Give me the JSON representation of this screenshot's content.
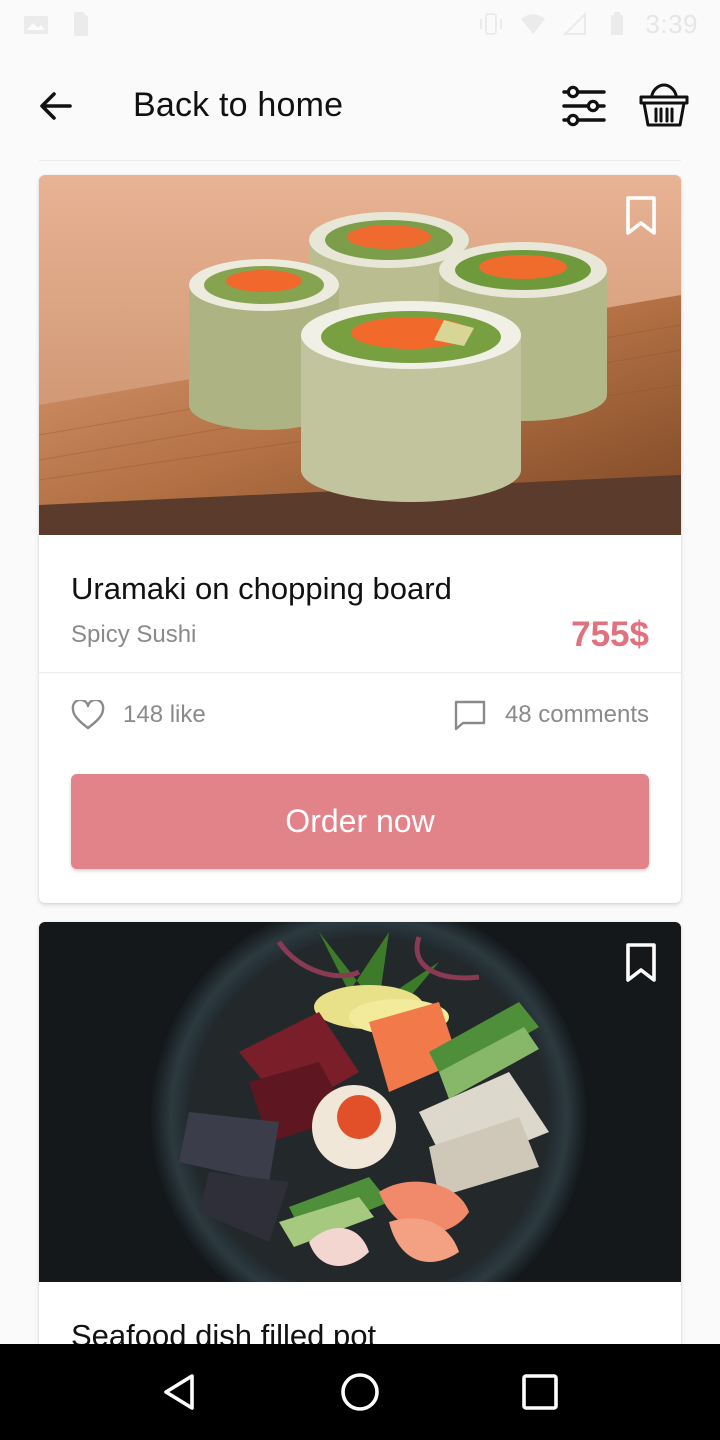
{
  "status_bar": {
    "time": "3:39"
  },
  "header": {
    "back_label": "Back to home"
  },
  "cards": [
    {
      "title": "Uramaki on chopping board",
      "subtitle": "Spicy Sushi",
      "price": "755$",
      "likes": "148 like",
      "comments": "48 comments",
      "order_label": "Order now",
      "image_icon": "sushi-rolls-photo"
    },
    {
      "title": "Seafood dish filled pot",
      "image_icon": "seafood-bowl-photo"
    }
  ],
  "colors": {
    "accent": "#e2838a",
    "price": "#e0717d"
  }
}
